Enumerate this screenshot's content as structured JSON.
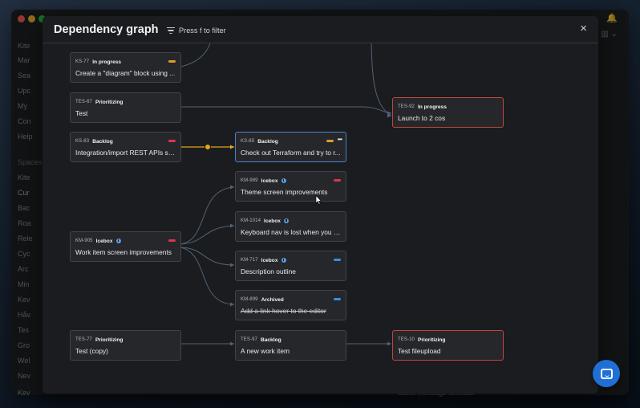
{
  "app": {
    "sidebar_items": [
      "Kite",
      "Mar",
      "Sea",
      "Upc",
      "My",
      "Con",
      "Help",
      "Spaces",
      "Kite",
      "Cur",
      "Bac",
      "Roa",
      "Rele",
      "Cyc",
      "Arc",
      "Min",
      "Kev",
      "Håv",
      "Tes",
      "Gro",
      "Wel",
      "Nev",
      "Kev"
    ],
    "footer_text": "Slack message shortcut"
  },
  "modal": {
    "title": "Dependency graph",
    "filter_label": "Press f to filter",
    "close_label": "×"
  },
  "colors": {
    "orange": "#e29a2d",
    "red": "#d9384a",
    "blue": "#3b8fe0",
    "edge": "#4f6377",
    "edge_highlight": "#e6a21e"
  },
  "cards": [
    {
      "key": "ks77",
      "id": "KS-77",
      "status": "In progress",
      "title": "Create a \"diagram\" block using ...",
      "priority": "orange"
    },
    {
      "key": "tes67",
      "id": "TES-67",
      "status": "Prioritizing",
      "title": "Test"
    },
    {
      "key": "ks83",
      "id": "KS-83",
      "status": "Backlog",
      "title": "Integration/import REST APIs sh...",
      "priority": "red"
    },
    {
      "key": "km905",
      "id": "KM-905",
      "status": "Icebox",
      "title": "Work item screen improvements",
      "priority": "red",
      "icon": "info-icon"
    },
    {
      "key": "tes77",
      "id": "TES-77",
      "status": "Prioritizing",
      "title": "Test (copy)"
    },
    {
      "key": "ks85",
      "id": "KS-85",
      "status": "Backlog",
      "title": "Check out Terraform and try to r...",
      "priority": "orange",
      "more": "•••"
    },
    {
      "key": "km989",
      "id": "KM-989",
      "status": "Icebox",
      "title": "Theme screen improvements",
      "priority": "red",
      "icon": "info-icon"
    },
    {
      "key": "km1014",
      "id": "KM-1014",
      "status": "Icebox",
      "title": "Keyboard nav is lost when you a...",
      "icon": "info-icon"
    },
    {
      "key": "km717",
      "id": "KM-717",
      "status": "Icebox",
      "title": "Description outline",
      "priority": "blue",
      "icon": "info-icon"
    },
    {
      "key": "km899",
      "id": "KM-899",
      "status": "Archived",
      "title": "Add a link hover to the editor",
      "priority": "blue",
      "strikethrough": true
    },
    {
      "key": "tes97",
      "id": "TES-97",
      "status": "Backlog",
      "title": "A new work item"
    },
    {
      "key": "tes92",
      "id": "TES-92",
      "status": "In progress",
      "title": "Launch to 2 cos"
    },
    {
      "key": "tes10",
      "id": "TES-10",
      "status": "Prioritizing",
      "title": "Test fileupload"
    }
  ]
}
